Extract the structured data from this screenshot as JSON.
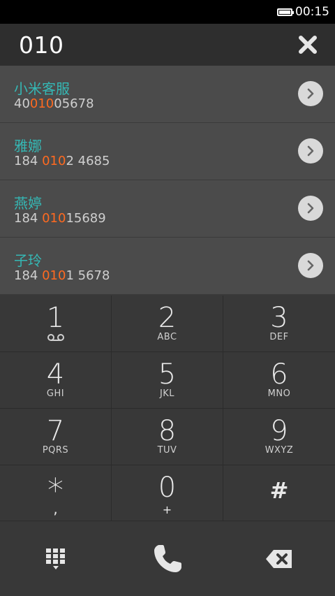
{
  "status_bar": {
    "time": "00:15"
  },
  "input": {
    "dialed_number": "010"
  },
  "results": [
    {
      "name": "小米客服",
      "number_pre": "40",
      "number_match": "010",
      "number_post": "05678"
    },
    {
      "name": "雅娜",
      "number_pre": "184 ",
      "number_match": "010",
      "number_post": "2 4685"
    },
    {
      "name": "燕婷",
      "number_pre": "184 ",
      "number_match": "010",
      "number_post": "15689"
    },
    {
      "name": "子玲",
      "number_pre": "184 ",
      "number_match": "010",
      "number_post": "1 5678"
    }
  ],
  "keypad": {
    "k1": {
      "digit": "1"
    },
    "k2": {
      "digit": "2",
      "letters": "ABC"
    },
    "k3": {
      "digit": "3",
      "letters": "DEF"
    },
    "k4": {
      "digit": "4",
      "letters": "GHI"
    },
    "k5": {
      "digit": "5",
      "letters": "JKL"
    },
    "k6": {
      "digit": "6",
      "letters": "MNO"
    },
    "k7": {
      "digit": "7",
      "letters": "PQRS"
    },
    "k8": {
      "digit": "8",
      "letters": "TUV"
    },
    "k9": {
      "digit": "9",
      "letters": "WXYZ"
    },
    "kstar": {
      "digit": "*",
      "letters": ","
    },
    "k0": {
      "digit": "0",
      "letters": "+"
    },
    "khash": {
      "digit": "#"
    }
  },
  "colors": {
    "name": "#35b8b5",
    "match_highlight": "#ff6a20"
  }
}
